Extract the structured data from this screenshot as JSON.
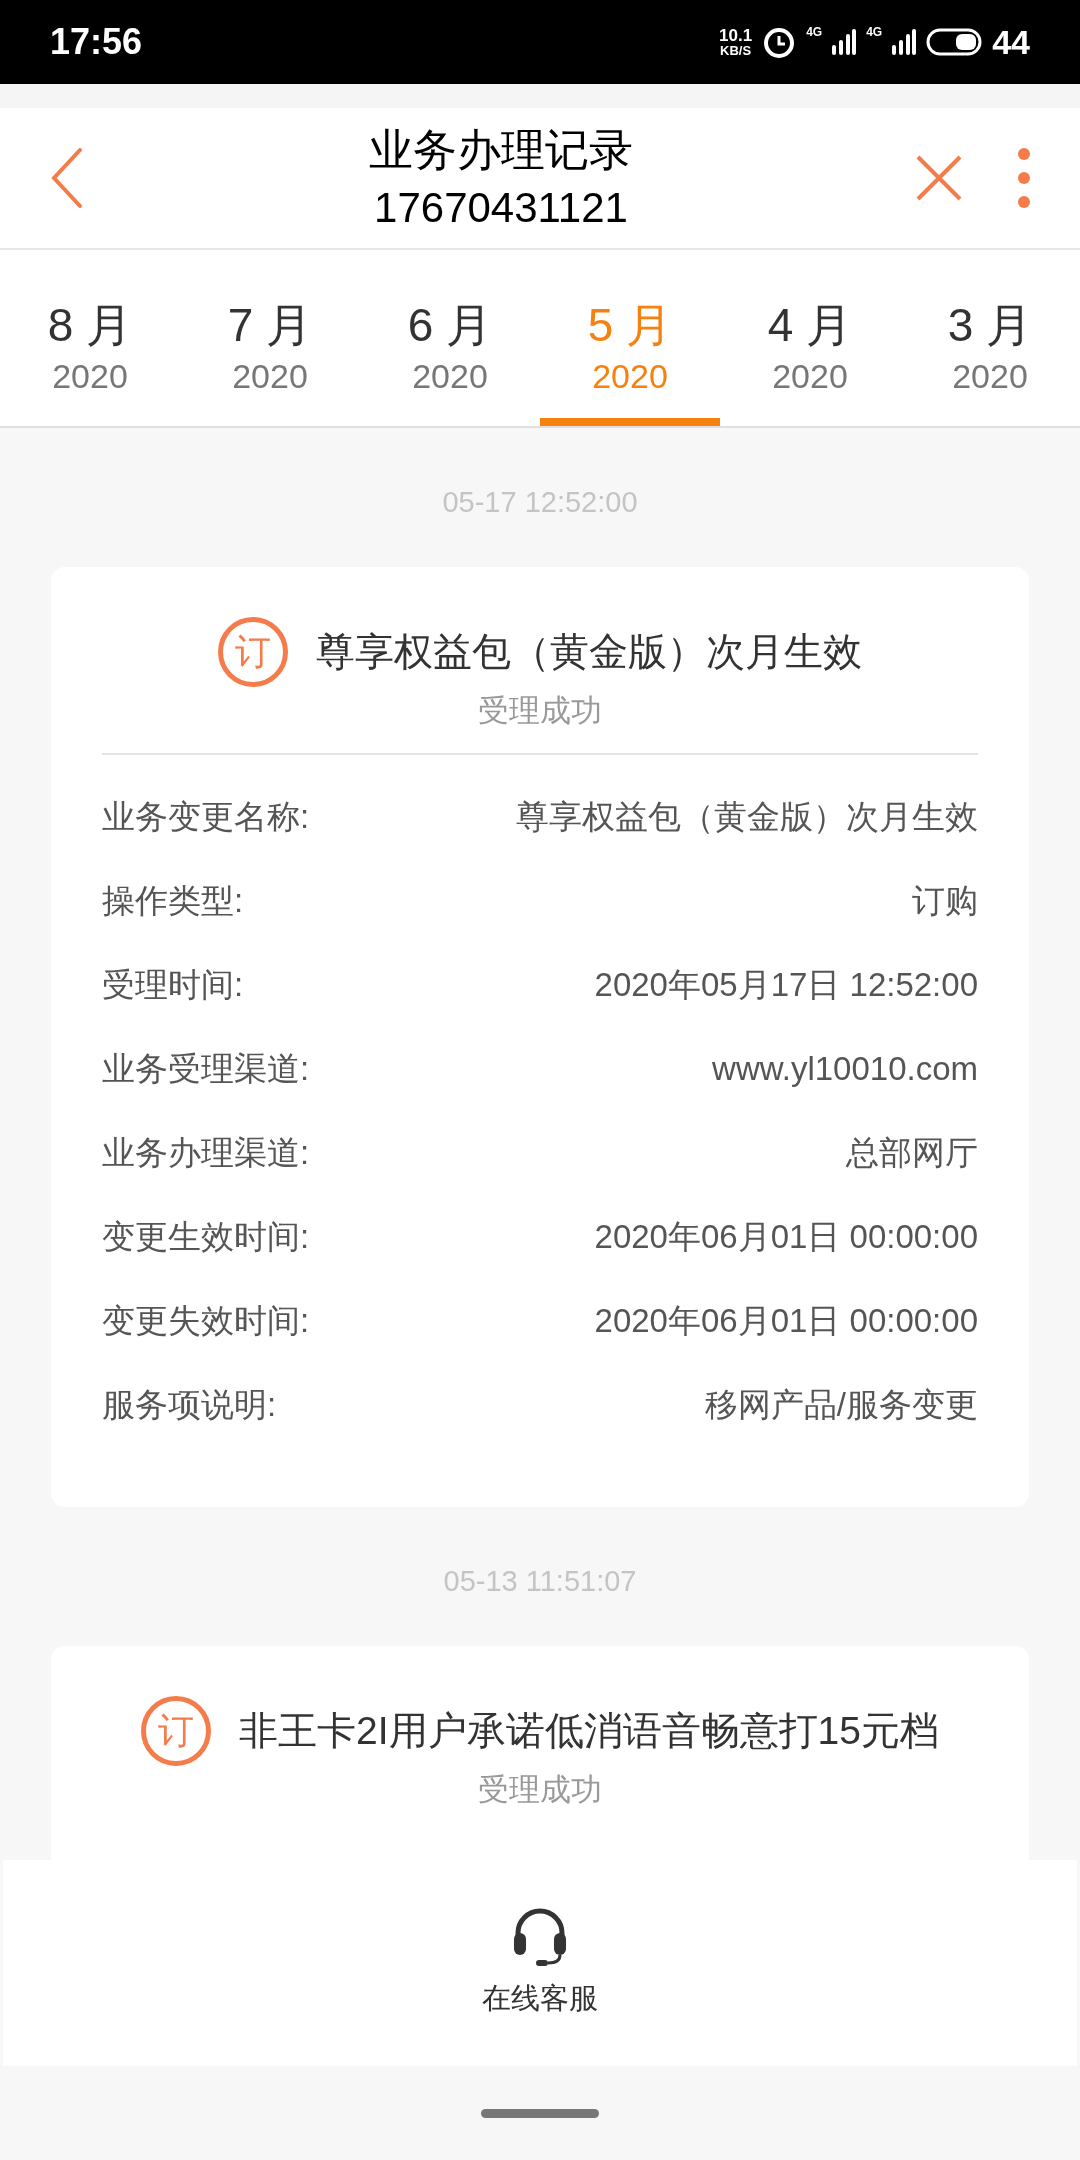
{
  "status_bar": {
    "time": "17:56",
    "speed": "10.1",
    "speed_unit": "KB/S",
    "network_1": "4G",
    "network_2": "4G",
    "battery": "44"
  },
  "header": {
    "title": "业务办理记录",
    "subtitle": "17670431121"
  },
  "tabs": [
    {
      "month": "8 月",
      "year": "2020",
      "selected": false
    },
    {
      "month": "7 月",
      "year": "2020",
      "selected": false
    },
    {
      "month": "6 月",
      "year": "2020",
      "selected": false
    },
    {
      "month": "5 月",
      "year": "2020",
      "selected": true
    },
    {
      "month": "4 月",
      "year": "2020",
      "selected": false
    },
    {
      "month": "3 月",
      "year": "2020",
      "selected": false
    }
  ],
  "records": [
    {
      "timestamp": "05-17 12:52:00",
      "badge": "订",
      "title": "尊享权益包（黄金版）次月生效",
      "status": "受理成功",
      "details": [
        {
          "label": "业务变更名称:",
          "value": "尊享权益包（黄金版）次月生效"
        },
        {
          "label": "操作类型:",
          "value": "订购"
        },
        {
          "label": "受理时间:",
          "value": "2020年05月17日 12:52:00"
        },
        {
          "label": "业务受理渠道:",
          "value": "www.yl10010.com"
        },
        {
          "label": "业务办理渠道:",
          "value": "总部网厅"
        },
        {
          "label": "变更生效时间:",
          "value": "2020年06月01日 00:00:00"
        },
        {
          "label": "变更失效时间:",
          "value": "2020年06月01日 00:00:00"
        },
        {
          "label": "服务项说明:",
          "value": "移网产品/服务变更"
        }
      ]
    },
    {
      "timestamp": "05-13 11:51:07",
      "badge": "订",
      "title": "非王卡2I用户承诺低消语音畅意打15元档",
      "status": "受理成功"
    }
  ],
  "bottom_bar": {
    "label": "在线客服"
  }
}
